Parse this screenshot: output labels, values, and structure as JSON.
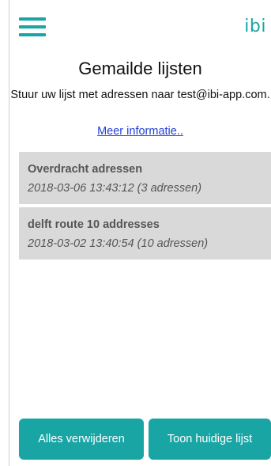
{
  "header": {
    "menu_icon": "hamburger-menu-icon",
    "logo_text": "ibi",
    "accent_color": "#1aa5a5"
  },
  "page": {
    "title": "Gemailde lijsten",
    "instructions": "Stuur uw lijst met adressen naar test@ibi-app.com.",
    "more_info_link": "Meer informatie.."
  },
  "lists": [
    {
      "name": "Overdracht adressen",
      "meta": "2018-03-06 13:43:12 (3 adressen)"
    },
    {
      "name": "delft route 10 addresses",
      "meta": "2018-03-02 13:40:54 (10 adressen)"
    }
  ],
  "actions": {
    "delete_all_label": "Alles verwijderen",
    "show_current_label": "Toon huidige lijst"
  }
}
